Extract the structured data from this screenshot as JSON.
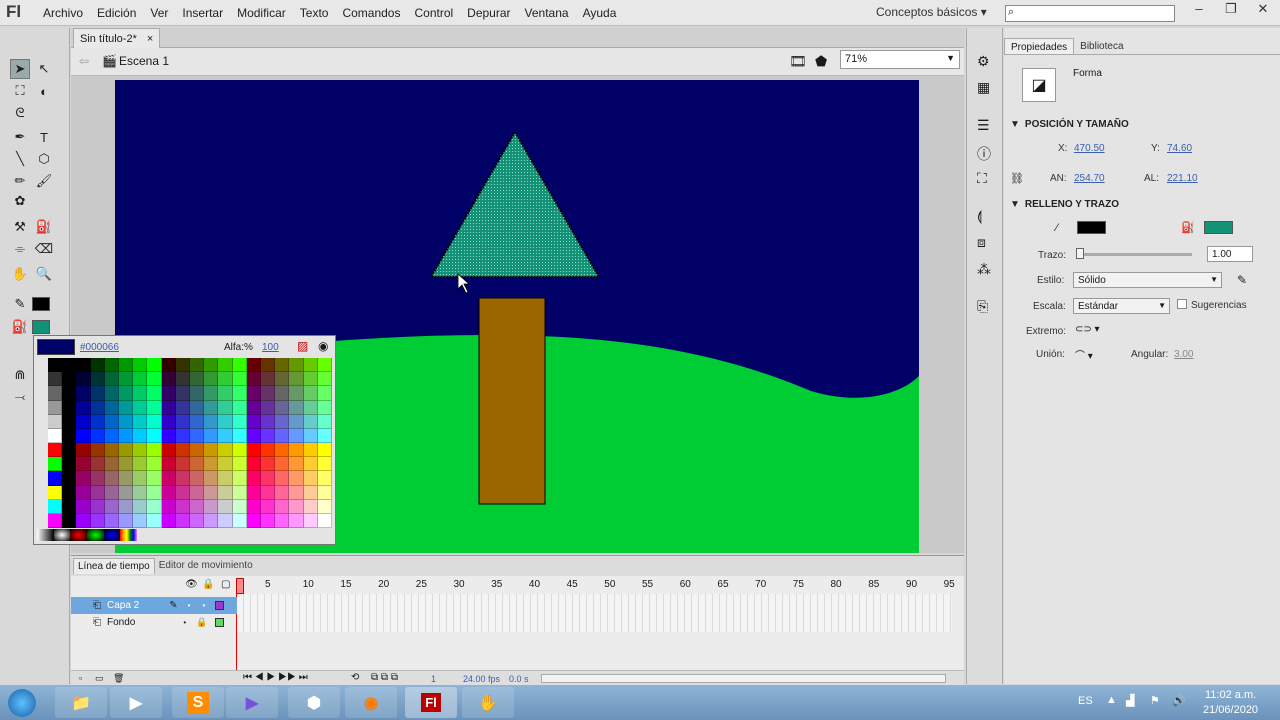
{
  "app": {
    "logo": "Fl",
    "workspace": "Conceptos básicos"
  },
  "menu": [
    "Archivo",
    "Edición",
    "Ver",
    "Insertar",
    "Modificar",
    "Texto",
    "Comandos",
    "Control",
    "Depurar",
    "Ventana",
    "Ayuda"
  ],
  "document": {
    "tab": "Sin título-2*",
    "close": "×",
    "scene": "Escena 1",
    "zoom": "71%"
  },
  "color_picker": {
    "hex": "#000066",
    "alpha_label": "Alfa:%",
    "alpha_value": "100"
  },
  "timeline": {
    "tabs": [
      "Línea de tiempo",
      "Editor de movimiento"
    ],
    "frame_numbers": [
      "1",
      "5",
      "10",
      "15",
      "20",
      "25",
      "30",
      "35",
      "40",
      "45",
      "50",
      "55",
      "60",
      "65",
      "70",
      "75",
      "80",
      "85",
      "90",
      "95"
    ],
    "layers": [
      {
        "name": "Capa 2",
        "selected": true
      },
      {
        "name": "Fondo",
        "selected": false
      }
    ],
    "status": {
      "frame": "1",
      "fps": "24.00 fps",
      "time": "0.0 s"
    }
  },
  "properties": {
    "tabs": [
      "Propiedades",
      "Biblioteca"
    ],
    "type": "Forma",
    "pos_section": "POSICIÓN Y TAMAÑO",
    "x_label": "X:",
    "x": "470.50",
    "y_label": "Y:",
    "y": "74.60",
    "w_label": "AN:",
    "w": "254.70",
    "h_label": "AL:",
    "h": "221.10",
    "fill_section": "RELLENO Y TRAZO",
    "stroke_color": "#000000",
    "fill_color": "#149278",
    "trazo_label": "Trazo:",
    "trazo_value": "1.00",
    "estilo_label": "Estilo:",
    "estilo_value": "Sólido",
    "escala_label": "Escala:",
    "escala_value": "Estándar",
    "sugerencias": "Sugerencias",
    "extremo_label": "Extremo:",
    "union_label": "Unión:",
    "angular_label": "Angular:",
    "angular_value": "3.00"
  },
  "taskbar": {
    "lang": "ES",
    "time": "11:02 a.m.",
    "date": "21/06/2020"
  },
  "colors": {
    "stage_bg": "#000066",
    "hill": "#00cc33",
    "trunk": "#996600",
    "tree": "#149278"
  }
}
